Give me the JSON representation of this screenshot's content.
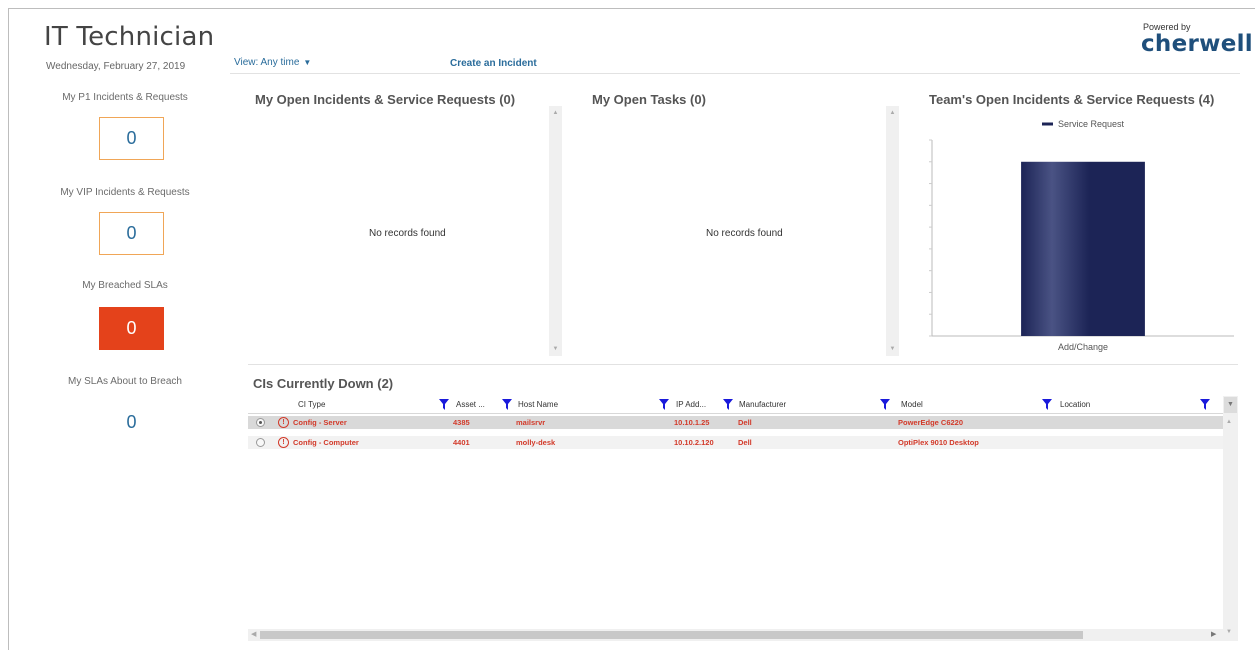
{
  "header": {
    "title": "IT Technician",
    "date": "Wednesday, February 27, 2019",
    "view_label": "View: Any time",
    "create_link": "Create an Incident",
    "powered_by": "Powered by",
    "logo": "cherwell"
  },
  "kpis": [
    {
      "label": "My P1 Incidents & Requests",
      "value": "0"
    },
    {
      "label": "My VIP Incidents & Requests",
      "value": "0"
    },
    {
      "label": "My Breached SLAs",
      "value": "0"
    },
    {
      "label": "My SLAs About to Breach",
      "value": "0"
    }
  ],
  "panels": {
    "open_incidents": {
      "title": "My Open Incidents & Service Requests (0)",
      "empty": "No records found"
    },
    "open_tasks": {
      "title": "My Open Tasks (0)",
      "empty": "No records found"
    },
    "team": {
      "title": "Team's Open Incidents & Service Requests (4)"
    }
  },
  "chart_data": {
    "type": "bar",
    "title": "Team's Open Incidents & Service Requests (4)",
    "categories": [
      "Add/Change"
    ],
    "series": [
      {
        "name": "Service Request",
        "values": [
          4
        ]
      }
    ],
    "ylim": [
      0,
      4.5
    ],
    "legend": "top-center",
    "colors": {
      "bar": "#1c2456",
      "bar_highlight": "#4a5384"
    }
  },
  "grid": {
    "title": "CIs Currently Down (2)",
    "columns": [
      "CI Type",
      "Asset ...",
      "Host Name",
      "IP Add...",
      "Manufacturer",
      "Model",
      "Location"
    ],
    "rows": [
      {
        "ci_type": "Config - Server",
        "asset": "4385",
        "host": "mailsrvr",
        "ip": "10.10.1.25",
        "manufacturer": "Dell",
        "model": "PowerEdge C6220",
        "location": "",
        "selected": true
      },
      {
        "ci_type": "Config - Computer",
        "asset": "4401",
        "host": "molly-desk",
        "ip": "10.10.2.120",
        "manufacturer": "Dell",
        "model": "OptiPlex 9010 Desktop",
        "location": "",
        "selected": false
      }
    ]
  },
  "colors": {
    "link": "#2a6c9b",
    "alert_red": "#e4421b",
    "kpi_border": "#f0a657",
    "row_text": "#d23a2a",
    "filter_blue": "#1a1adb"
  }
}
